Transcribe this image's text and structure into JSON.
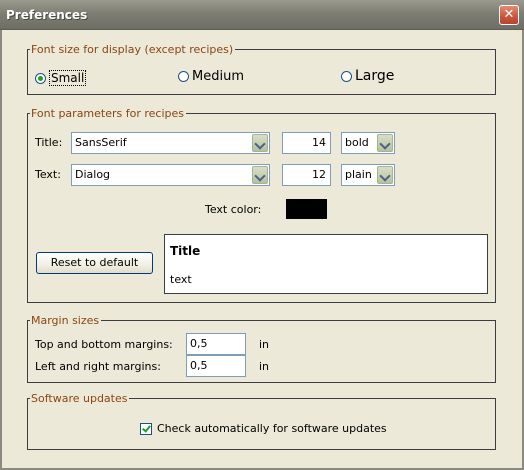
{
  "window": {
    "title": "Preferences",
    "close_glyph": "✕"
  },
  "font_size_group": {
    "legend": "Font size for display (except recipes)",
    "options": [
      {
        "label": "Small",
        "checked": true
      },
      {
        "label": "Medium",
        "checked": false
      },
      {
        "label": "Large",
        "checked": false
      }
    ]
  },
  "font_params_group": {
    "legend": "Font parameters for recipes",
    "title_row": {
      "label": "Title:",
      "font": "SansSerif",
      "size": "14",
      "style": "bold"
    },
    "text_row": {
      "label": "Text:",
      "font": "Dialog",
      "size": "12",
      "style": "plain"
    },
    "text_color_label": "Text color:",
    "text_color": "#000000",
    "reset_button": "Reset to default",
    "preview": {
      "title": "Title",
      "text": "text"
    }
  },
  "margins_group": {
    "legend": "Margin sizes",
    "top_bottom": {
      "label": "Top and bottom margins:",
      "value": "0,5",
      "unit": "in"
    },
    "left_right": {
      "label": "Left and right margins:",
      "value": "0,5",
      "unit": "in"
    }
  },
  "updates_group": {
    "legend": "Software updates",
    "auto_check": {
      "label": "Check automatically for software updates",
      "checked": true
    }
  },
  "colors": {
    "legend_text": "#8b4513",
    "radio_dot": "#21a121",
    "check_mark": "#21a121",
    "titlebar": "#7f7e74",
    "dialog_bg": "#ece9d8"
  }
}
